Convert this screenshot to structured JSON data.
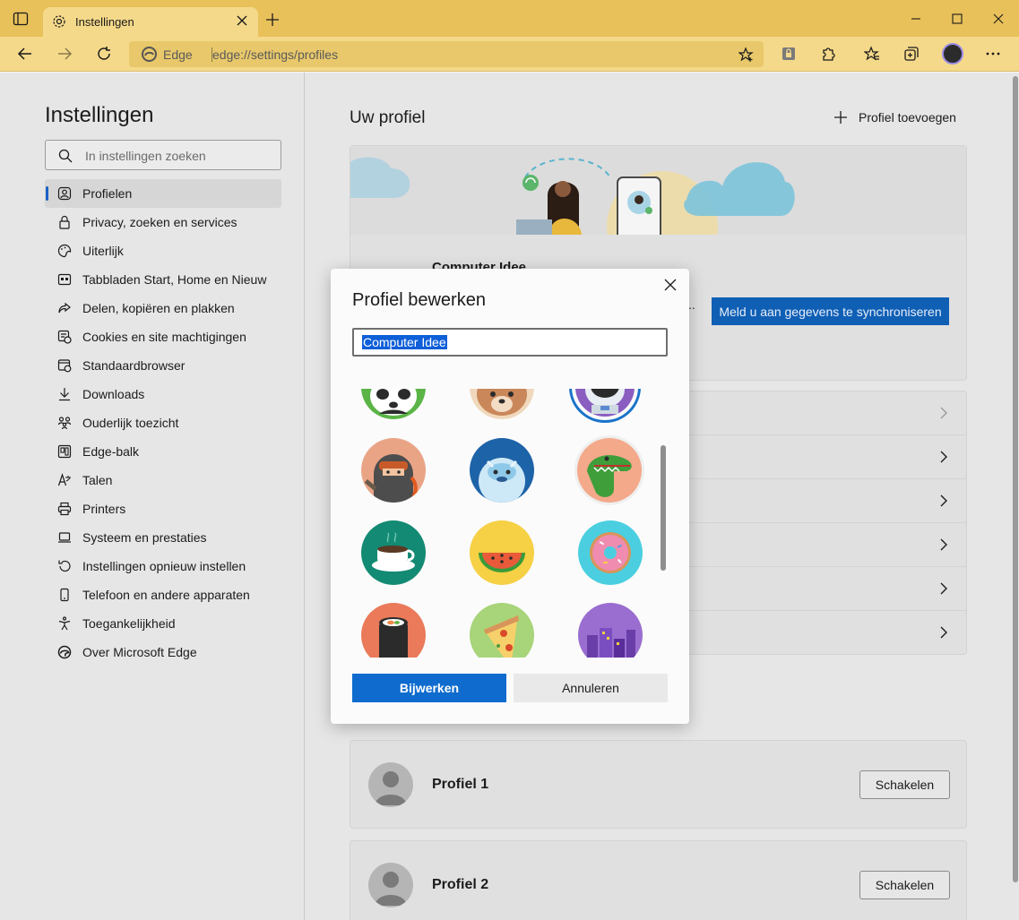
{
  "browser": {
    "tab_title": "Instellingen",
    "address_brand": "Edge",
    "address_url": "edge://settings/profiles"
  },
  "sidebar": {
    "title": "Instellingen",
    "search_placeholder": "In instellingen zoeken",
    "items": [
      {
        "label": "Profielen",
        "icon": "profile-icon",
        "active": true
      },
      {
        "label": "Privacy, zoeken en services",
        "icon": "lock-icon"
      },
      {
        "label": "Uiterlijk",
        "icon": "palette-icon"
      },
      {
        "label": "Tabbladen Start, Home en Nieuw",
        "icon": "tabs-icon"
      },
      {
        "label": "Delen, kopiëren en plakken",
        "icon": "share-icon"
      },
      {
        "label": "Cookies en site machtigingen",
        "icon": "cookie-icon"
      },
      {
        "label": "Standaardbrowser",
        "icon": "browser-icon"
      },
      {
        "label": "Downloads",
        "icon": "download-icon"
      },
      {
        "label": "Ouderlijk toezicht",
        "icon": "family-icon"
      },
      {
        "label": "Edge-balk",
        "icon": "edgebar-icon"
      },
      {
        "label": "Talen",
        "icon": "language-icon"
      },
      {
        "label": "Printers",
        "icon": "printer-icon"
      },
      {
        "label": "Systeem en prestaties",
        "icon": "laptop-icon"
      },
      {
        "label": "Instellingen opnieuw instellen",
        "icon": "reset-icon"
      },
      {
        "label": "Telefoon en andere apparaten",
        "icon": "phone-icon"
      },
      {
        "label": "Toegankelijkheid",
        "icon": "accessibility-icon"
      },
      {
        "label": "Over Microsoft Edge",
        "icon": "edge-icon"
      }
    ]
  },
  "main": {
    "title": "Uw profiel",
    "add_profile": "Profiel toevoegen",
    "current_profile_name": "Computer Idee",
    "sync_button": "Meld u aan gegevens te synchroniseren",
    "other_profiles": [
      {
        "name": "Profiel 1",
        "switch_label": "Schakelen"
      },
      {
        "name": "Profiel 2",
        "switch_label": "Schakelen"
      }
    ]
  },
  "dialog": {
    "title": "Profiel bewerken",
    "name_value": "Computer Idee",
    "update_button": "Bijwerken",
    "cancel_button": "Annuleren",
    "avatars": [
      "panda",
      "fox",
      "astronaut",
      "ninja",
      "yeti",
      "dinosaur",
      "coffee",
      "watermelon",
      "donut",
      "sushi",
      "pizza",
      "city"
    ],
    "selected_avatar": "astronaut"
  },
  "colors": {
    "titlebar": "#e8c15a",
    "accent": "#0f6cce"
  }
}
